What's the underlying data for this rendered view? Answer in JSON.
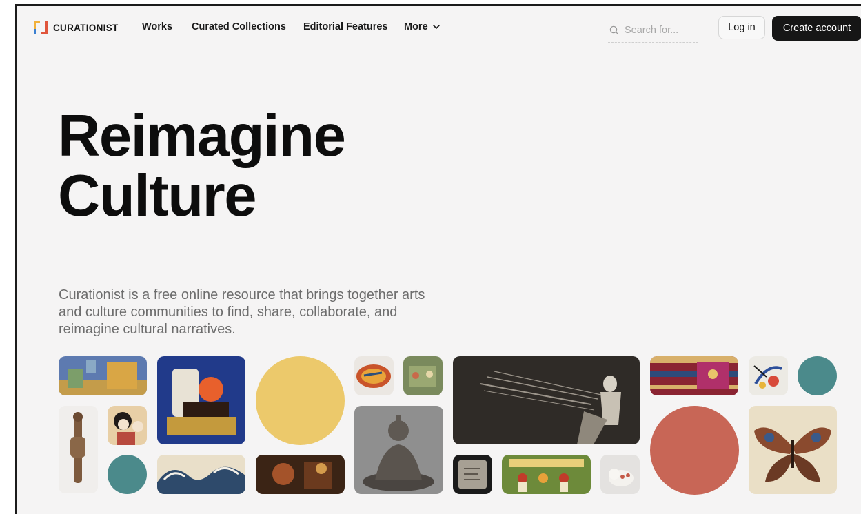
{
  "brand": {
    "name": "CURATIONIST"
  },
  "nav": {
    "links": [
      "Works",
      "Curated Collections",
      "Editorial Features"
    ],
    "more_label": "More"
  },
  "search": {
    "placeholder": "Search for..."
  },
  "auth": {
    "login_label": "Log in",
    "create_label": "Create account"
  },
  "hero": {
    "title_line1": "Reimagine",
    "title_line2": "Culture",
    "description": "Curationist is a free online resource that brings together arts and culture communities to find, share, collaborate, and reimagine cultural narratives."
  },
  "colors": {
    "yellow": "#ecc96b",
    "teal": "#4b8a8b",
    "coral": "#c86656",
    "dark": "#161616",
    "logo_yellow": "#f2b13a",
    "logo_blue": "#3a7fd0",
    "logo_red": "#e0553c"
  },
  "icons": {
    "search": "search-icon",
    "more": "chevron-down-icon"
  }
}
